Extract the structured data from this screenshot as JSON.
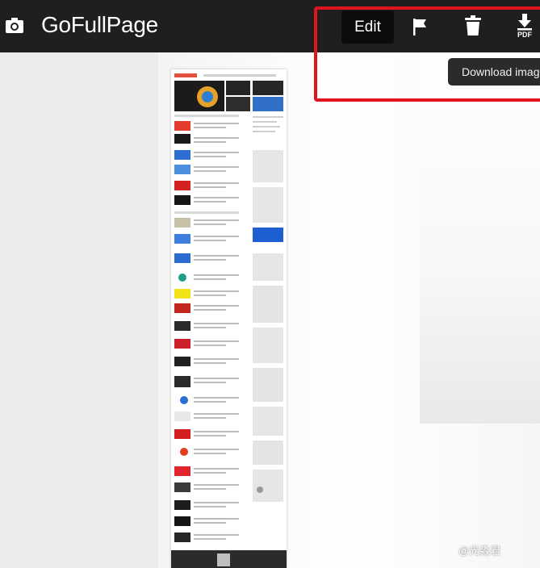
{
  "app": {
    "title": "GoFullPage",
    "icon": "camera-icon"
  },
  "toolbar": {
    "edit_label": "Edit",
    "flag_icon": "flag-icon",
    "trash_icon": "trash-icon",
    "pdf_icon": "download-pdf-icon",
    "pdf_label": "PDF",
    "tooltip": "Download image"
  },
  "highlight_color": "#e0141c",
  "watermark": "@光淼君"
}
